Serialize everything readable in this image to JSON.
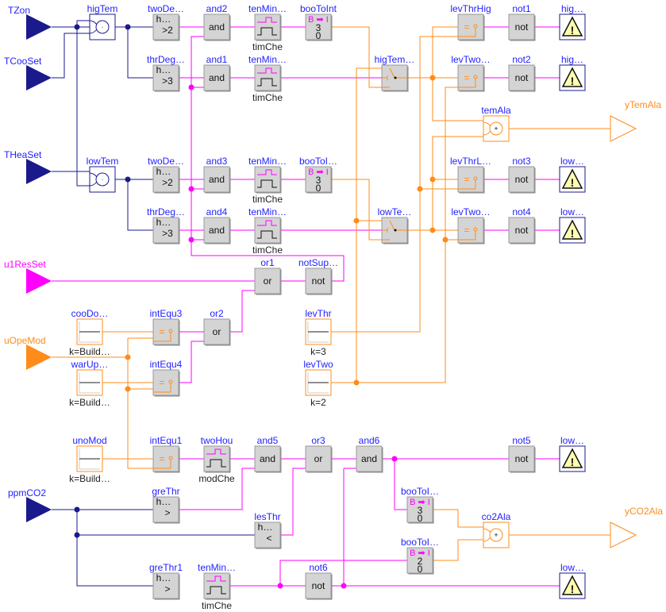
{
  "colors": {
    "real": "#1a1a8c",
    "boolean": "#ff00ff",
    "integer": "#ff8c1a",
    "block_fill": "#d4d4d4",
    "label": "#1f1fff",
    "alarm_fill": "#ffffb0"
  },
  "inputs": [
    {
      "id": "TZon",
      "label": "TZon",
      "kind": "real"
    },
    {
      "id": "TCooSet",
      "label": "TCooSet",
      "kind": "real"
    },
    {
      "id": "THeaSet",
      "label": "THeaSet",
      "kind": "real"
    },
    {
      "id": "u1ResSet",
      "label": "u1ResSet",
      "kind": "boolean"
    },
    {
      "id": "uOpeMod",
      "label": "uOpeMod",
      "kind": "integer"
    },
    {
      "id": "ppmCO2",
      "label": "ppmCO2",
      "kind": "real"
    }
  ],
  "outputs": [
    {
      "id": "yTemAla",
      "label": "yTemAla"
    },
    {
      "id": "yCO2Ala",
      "label": "yCO2Ala"
    }
  ],
  "blocks": [
    {
      "id": "higTem",
      "label": "higTem",
      "type": "sub",
      "text": "-"
    },
    {
      "id": "lowTem",
      "label": "lowTem",
      "type": "sub",
      "text": "-"
    },
    {
      "id": "twoDe1",
      "label": "twoDe…",
      "type": "gt",
      "text": "h…",
      "op": ">2"
    },
    {
      "id": "thrDeg1",
      "label": "thrDeg…",
      "type": "gt",
      "text": "h…",
      "op": ">3"
    },
    {
      "id": "twoDe2",
      "label": "twoDe…",
      "type": "gt",
      "text": "h…",
      "op": ">2"
    },
    {
      "id": "thrDeg2",
      "label": "thrDeg…",
      "type": "gt",
      "text": "h…",
      "op": ">3"
    },
    {
      "id": "and2",
      "label": "and2",
      "type": "logic",
      "text": "and"
    },
    {
      "id": "and1",
      "label": "and1",
      "type": "logic",
      "text": "and"
    },
    {
      "id": "and3",
      "label": "and3",
      "type": "logic",
      "text": "and"
    },
    {
      "id": "and4",
      "label": "and4",
      "type": "logic",
      "text": "and"
    },
    {
      "id": "tenMin1",
      "label": "tenMin…",
      "type": "timer",
      "caption": "timChe"
    },
    {
      "id": "tenMin2",
      "label": "tenMin…",
      "type": "timer",
      "caption": "timChe"
    },
    {
      "id": "tenMin3",
      "label": "tenMin…",
      "type": "timer",
      "caption": "timChe"
    },
    {
      "id": "tenMin4",
      "label": "tenMin…",
      "type": "timer",
      "caption": "timChe"
    },
    {
      "id": "booToInt",
      "label": "booToInt",
      "type": "b2i",
      "head": "B ➡ I",
      "v1": "3",
      "v2": "0"
    },
    {
      "id": "booToI1",
      "label": "booToI…",
      "type": "b2i",
      "head": "B ➡ I",
      "v1": "3",
      "v2": "0"
    },
    {
      "id": "higTemSw",
      "label": "higTem…",
      "type": "switch"
    },
    {
      "id": "lowTeSw",
      "label": "lowTe…",
      "type": "switch"
    },
    {
      "id": "levThrHig",
      "label": "levThrHig",
      "type": "eq",
      "text": "="
    },
    {
      "id": "levTwo1",
      "label": "levTwo…",
      "type": "eq",
      "text": "="
    },
    {
      "id": "levThrL",
      "label": "levThrL…",
      "type": "eq",
      "text": "="
    },
    {
      "id": "levTwo2",
      "label": "levTwo…",
      "type": "eq",
      "text": "="
    },
    {
      "id": "not1",
      "label": "not1",
      "type": "logic",
      "text": "not"
    },
    {
      "id": "not2",
      "label": "not2",
      "type": "logic",
      "text": "not"
    },
    {
      "id": "not3",
      "label": "not3",
      "type": "logic",
      "text": "not"
    },
    {
      "id": "not4",
      "label": "not4",
      "type": "logic",
      "text": "not"
    },
    {
      "id": "ala1",
      "label": "hig…",
      "type": "alarm"
    },
    {
      "id": "ala2",
      "label": "hig…",
      "type": "alarm"
    },
    {
      "id": "ala3",
      "label": "low…",
      "type": "alarm"
    },
    {
      "id": "ala4",
      "label": "low…",
      "type": "alarm"
    },
    {
      "id": "temAla",
      "label": "temAla",
      "type": "add",
      "text": "+"
    },
    {
      "id": "or1",
      "label": "or1",
      "type": "logic",
      "text": "or"
    },
    {
      "id": "notSup",
      "label": "notSup…",
      "type": "logic",
      "text": "not"
    },
    {
      "id": "cooDo",
      "label": "cooDo…",
      "type": "const",
      "caption": "k=Build…"
    },
    {
      "id": "warUp",
      "label": "warUp…",
      "type": "const",
      "caption": "k=Build…"
    },
    {
      "id": "unoMod",
      "label": "unoMod",
      "type": "const",
      "caption": "k=Build…"
    },
    {
      "id": "intEqu3",
      "label": "intEqu3",
      "type": "eq",
      "text": "="
    },
    {
      "id": "intEqu4",
      "label": "intEqu4",
      "type": "eq",
      "text": "="
    },
    {
      "id": "intEqu1",
      "label": "intEqu1",
      "type": "eq",
      "text": "="
    },
    {
      "id": "or2",
      "label": "or2",
      "type": "logic",
      "text": "or"
    },
    {
      "id": "levThr",
      "label": "levThr",
      "type": "const",
      "caption": "k=3"
    },
    {
      "id": "levTwo",
      "label": "levTwo",
      "type": "const",
      "caption": "k=2"
    },
    {
      "id": "twoHou",
      "label": "twoHou",
      "type": "timer",
      "caption": "modChe"
    },
    {
      "id": "and5",
      "label": "and5",
      "type": "logic",
      "text": "and"
    },
    {
      "id": "or3",
      "label": "or3",
      "type": "logic",
      "text": "or"
    },
    {
      "id": "and6",
      "label": "and6",
      "type": "logic",
      "text": "and"
    },
    {
      "id": "not5",
      "label": "not5",
      "type": "logic",
      "text": "not"
    },
    {
      "id": "ala5",
      "label": "low…",
      "type": "alarm"
    },
    {
      "id": "greThr",
      "label": "greThr",
      "type": "gt",
      "text": "h…",
      "op": ">"
    },
    {
      "id": "lesThr",
      "label": "lesThr",
      "type": "gt",
      "text": "h…",
      "op": "<"
    },
    {
      "id": "greThr1",
      "label": "greThr1",
      "type": "gt",
      "text": "h…",
      "op": ">"
    },
    {
      "id": "tenMin5",
      "label": "tenMin…",
      "type": "timer",
      "caption": "timChe"
    },
    {
      "id": "not6",
      "label": "not6",
      "type": "logic",
      "text": "not"
    },
    {
      "id": "ala6",
      "label": "low…",
      "type": "alarm"
    },
    {
      "id": "booToI2",
      "label": "booToI…",
      "type": "b2i",
      "head": "B ➡ I",
      "v1": "3",
      "v2": "0"
    },
    {
      "id": "booToI3",
      "label": "booToI…",
      "type": "b2i",
      "head": "B ➡ I",
      "v1": "2",
      "v2": "0"
    },
    {
      "id": "co2Ala",
      "label": "co2Ala",
      "type": "add",
      "text": "+"
    }
  ]
}
